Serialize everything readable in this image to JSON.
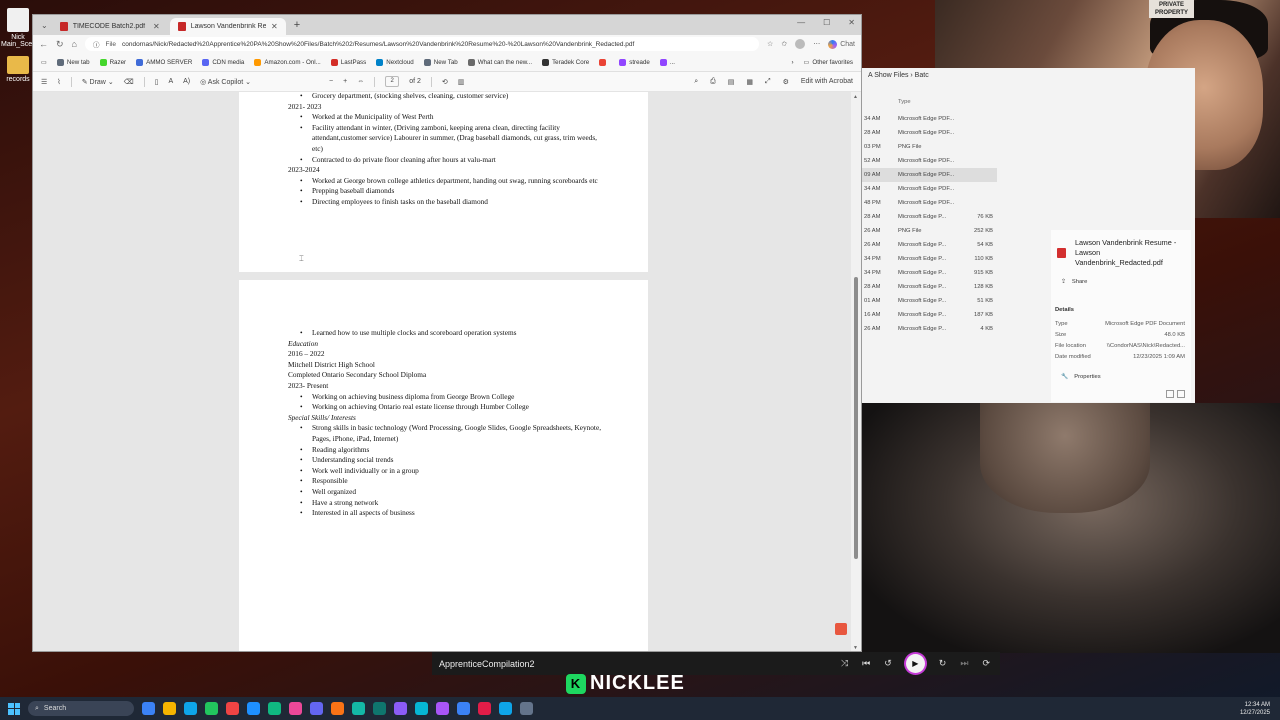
{
  "desktop": {
    "icons": [
      {
        "label": "Nick Main_Scen"
      },
      {
        "label": "records"
      }
    ]
  },
  "browser": {
    "tabs": [
      {
        "label": "TIMECODE Batch2.pdf"
      },
      {
        "label": "Lawson Vandenbrink Resume - La..."
      }
    ],
    "new_tab": "+",
    "address": {
      "scheme": "File",
      "url": "condornas/Nick/Redacted%20Apprentice%20PA%20Show%20Files/Batch%202/Resumes/Lawson%20Vandenbrink%20Resume%20-%20Lawson%20Vandenbrink_Redacted.pdf",
      "chat": "Chat"
    },
    "favorites": [
      {
        "label": "New tab",
        "color": "#5f6b7a"
      },
      {
        "label": "Razer",
        "color": "#44d62c"
      },
      {
        "label": "AMMO SERVER",
        "color": "#3f6bd8"
      },
      {
        "label": "CDN media",
        "color": "#5865f2"
      },
      {
        "label": "Amazon.com - Onl...",
        "color": "#ff9900"
      },
      {
        "label": "LastPass",
        "color": "#d32d27"
      },
      {
        "label": "Nextcloud",
        "color": "#0082c9"
      },
      {
        "label": "New Tab",
        "color": "#5f6b7a"
      },
      {
        "label": "What can the new...",
        "color": "#6a6a6a"
      },
      {
        "label": "Teradek Core",
        "color": "#333333"
      },
      {
        "label": "",
        "color": "#ea4335"
      },
      {
        "label": "streade",
        "color": "#9146ff"
      },
      {
        "label": "...",
        "color": "#9146ff"
      }
    ],
    "other_favorites": "Other favorites",
    "pdf_toolbar": {
      "draw": "Draw",
      "ask_copilot": "Ask Copilot",
      "page_current": "2",
      "page_total": "of 2",
      "edit_acrobat": "Edit with Acrobat"
    }
  },
  "document": {
    "page1_lines": [
      {
        "text": "Grocery department, (stocking shelves, cleaning, customer service)",
        "kind": "bullet"
      },
      {
        "text": "2021- 2023",
        "kind": "plain"
      },
      {
        "text": "Worked at the Municipality of West Perth",
        "kind": "bullet"
      },
      {
        "text": "Facility attendant in winter, (Driving zamboni, keeping arena clean, directing facility attendant,customer service) Labourer in summer, (Drag baseball diamonds, cut grass, trim weeds, etc)",
        "kind": "bullet"
      },
      {
        "text": "Contracted to do private floor cleaning after hours at valu-mart",
        "kind": "bullet"
      },
      {
        "text": "2023-2024",
        "kind": "plain"
      },
      {
        "text": "Worked at George brown college athletics department, handing out swag, running scoreboards etc",
        "kind": "bullet"
      },
      {
        "text": "Prepping baseball diamonds",
        "kind": "bullet"
      },
      {
        "text": "Directing employees to finish tasks on the baseball diamond",
        "kind": "bullet"
      }
    ],
    "page2_lines": [
      {
        "text": "Learned how to use multiple clocks and scoreboard operation systems",
        "kind": "bullet"
      },
      {
        "text": "Education",
        "kind": "italic"
      },
      {
        "text": "2016 – 2022",
        "kind": "plain"
      },
      {
        "text": "Mitchell District High School",
        "kind": "plain"
      },
      {
        "text": "Completed Ontario Secondary School Diploma",
        "kind": "plain"
      },
      {
        "text": "2023- Present",
        "kind": "plain"
      },
      {
        "text": "Working on achieving business diploma from George Brown College",
        "kind": "bullet"
      },
      {
        "text": "Working on achieving Ontario real estate license through Humber College",
        "kind": "bullet"
      },
      {
        "text": "Special Skills/ Interests",
        "kind": "italic"
      },
      {
        "text": "Strong skills in basic technology (Word Processing, Google Slides, Google Spreadsheets, Keynote, Pages, iPhone, iPad, Internet)",
        "kind": "bullet"
      },
      {
        "text": "Reading algorithms",
        "kind": "bullet"
      },
      {
        "text": "Understanding social trends",
        "kind": "bullet"
      },
      {
        "text": "Work well individually or in a group",
        "kind": "bullet"
      },
      {
        "text": "Responsible",
        "kind": "bullet"
      },
      {
        "text": "Well organized",
        "kind": "bullet"
      },
      {
        "text": "Have a strong network",
        "kind": "bullet"
      },
      {
        "text": "Interested in all aspects of business",
        "kind": "bullet"
      }
    ]
  },
  "webcam": {
    "sign_text": "PRIVATE PROPERTY"
  },
  "explorer": {
    "breadcrumb": "A Show Files  ›  Batc",
    "type_header": "Type",
    "rows": [
      {
        "date": "34 AM",
        "type": "Microsoft Edge PDF...",
        "size": ""
      },
      {
        "date": "28 AM",
        "type": "Microsoft Edge PDF...",
        "size": ""
      },
      {
        "date": "03 PM",
        "type": "PNG File",
        "size": ""
      },
      {
        "date": "52 AM",
        "type": "Microsoft Edge PDF...",
        "size": ""
      },
      {
        "date": "09 AM",
        "type": "Microsoft Edge PDF...",
        "size": ""
      },
      {
        "date": "34 AM",
        "type": "Microsoft Edge PDF...",
        "size": ""
      },
      {
        "date": "48 PM",
        "type": "Microsoft Edge PDF...",
        "size": ""
      },
      {
        "date": "28 AM",
        "type": "Microsoft Edge P...",
        "size": "76 KB"
      },
      {
        "date": "26 AM",
        "type": "PNG File",
        "size": "252 KB"
      },
      {
        "date": "26 AM",
        "type": "Microsoft Edge P...",
        "size": "54 KB"
      },
      {
        "date": "34 PM",
        "type": "Microsoft Edge P...",
        "size": "110 KB"
      },
      {
        "date": "34 PM",
        "type": "Microsoft Edge P...",
        "size": "915 KB"
      },
      {
        "date": "28 AM",
        "type": "Microsoft Edge P...",
        "size": "128 KB"
      },
      {
        "date": "01 AM",
        "type": "Microsoft Edge P...",
        "size": "51 KB"
      },
      {
        "date": "16 AM",
        "type": "Microsoft Edge P...",
        "size": "187 KB"
      },
      {
        "date": "26 AM",
        "type": "Microsoft Edge P...",
        "size": "4 KB"
      }
    ],
    "selected_index": 4,
    "details": {
      "title": "Lawson Vandenbrink Resume - Lawson Vandenbrink_Redacted.pdf",
      "share": "Share",
      "heading": "Details",
      "fields": [
        {
          "k": "Type",
          "v": "Microsoft Edge PDF Document"
        },
        {
          "k": "Size",
          "v": "48.0 KB"
        },
        {
          "k": "File location",
          "v": "\\\\CondorNAS\\Nick\\Redacted..."
        },
        {
          "k": "Date modified",
          "v": "12/23/2025 1:09 AM"
        }
      ],
      "properties": "Properties"
    }
  },
  "media": {
    "title": "ApprenticeCompilation2"
  },
  "brand": {
    "badge": "K",
    "name": "NICKLEE"
  },
  "taskbar": {
    "search_placeholder": "Search",
    "time": "12:34 AM",
    "date": "12/27/2025",
    "apps": [
      "#3b82f6",
      "#f5b400",
      "#0ea5e9",
      "#22c55e",
      "#ef4444",
      "#1e90ff",
      "#10b981",
      "#ec4899",
      "#6366f1",
      "#f97316",
      "#14b8a6",
      "#0f766e",
      "#8b5cf6",
      "#06b6d4",
      "#a855f7",
      "#3b82f6",
      "#e11d48",
      "#0ea5e9",
      "#64748b"
    ]
  }
}
